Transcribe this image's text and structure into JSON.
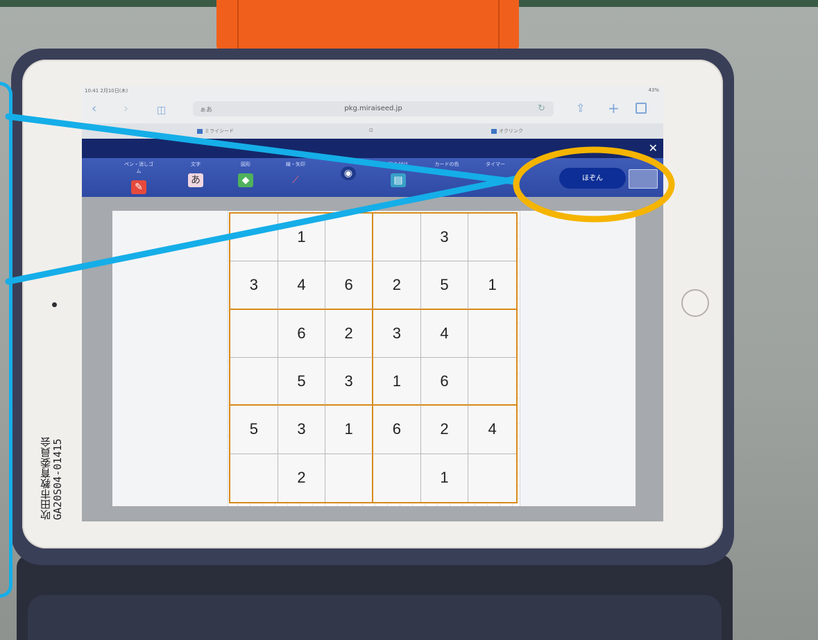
{
  "browser": {
    "status_time": "10:41 2月10日(木)",
    "battery": "43%",
    "aa": "ぁあ",
    "url": "pkg.miraiseed.jp",
    "tabs": [
      {
        "label": "ミライシード"
      },
      {
        "label": ""
      },
      {
        "label": "オクリンク"
      }
    ]
  },
  "app": {
    "tools": [
      {
        "label": "ペン・消しゴム",
        "icon": "pen-eraser-icon"
      },
      {
        "label": "文字",
        "icon": "text-icon",
        "glyph": "あ"
      },
      {
        "label": "図形",
        "icon": "shape-icon"
      },
      {
        "label": "線・矢印",
        "icon": "line-icon"
      },
      {
        "label": "",
        "icon": "stamp-icon"
      },
      {
        "label": "貼り付け",
        "icon": "paste-icon"
      },
      {
        "label": "カードの色",
        "icon": "card-color-icon"
      },
      {
        "label": "タイマー",
        "icon": "timer-icon"
      }
    ],
    "save_label": "ほぞん"
  },
  "puzzle": {
    "rows": [
      [
        "",
        "1",
        "",
        "",
        "3",
        ""
      ],
      [
        "3",
        "4",
        "6",
        "2",
        "5",
        "1"
      ],
      [
        "",
        "6",
        "2",
        "3",
        "4",
        ""
      ],
      [
        "",
        "5",
        "3",
        "1",
        "6",
        ""
      ],
      [
        "5",
        "3",
        "1",
        "6",
        "2",
        "4"
      ],
      [
        "",
        "2",
        "",
        "",
        "1",
        ""
      ]
    ]
  },
  "device": {
    "asset_label_line1": "吹田市教育委員会",
    "asset_label_line2": "GA20S04-01415"
  },
  "annotation_colors": {
    "arrow": "#15aee8",
    "highlight": "#f5b400"
  }
}
